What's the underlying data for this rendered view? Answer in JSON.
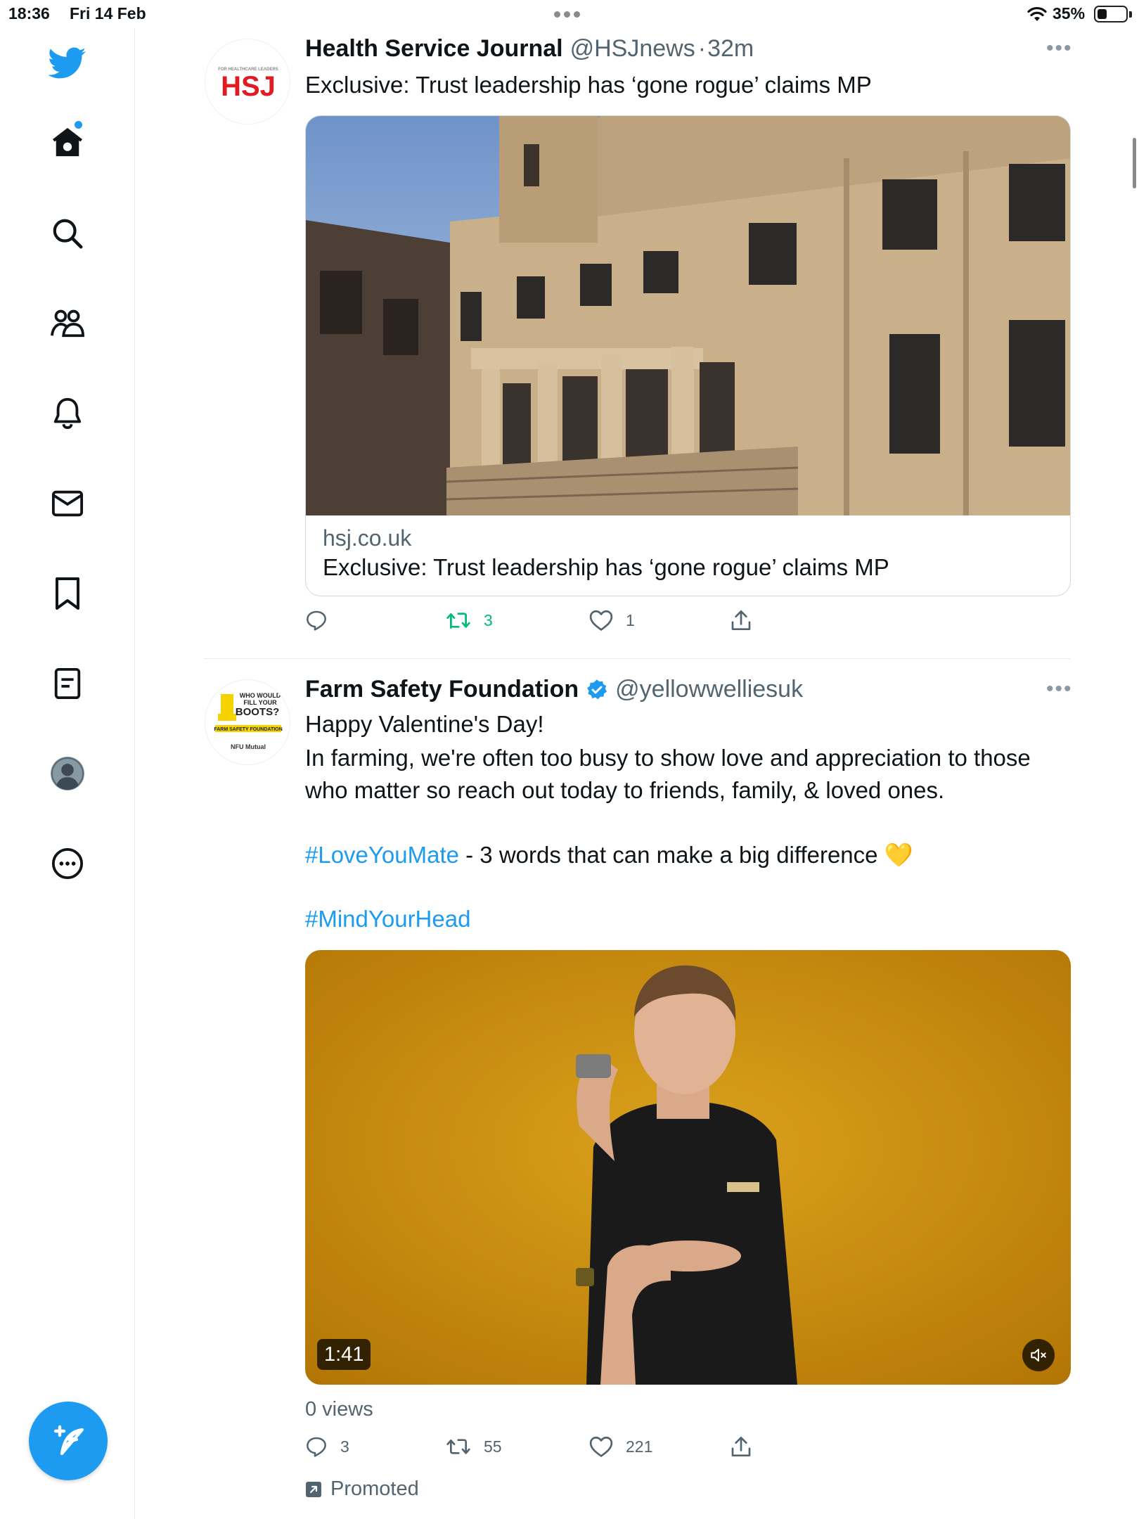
{
  "status_bar": {
    "time": "18:36",
    "date": "Fri 14 Feb",
    "battery": "35%"
  },
  "sidebar": {
    "items": [
      {
        "icon": "twitter-logo-icon"
      },
      {
        "icon": "home-icon"
      },
      {
        "icon": "search-icon"
      },
      {
        "icon": "communities-icon"
      },
      {
        "icon": "bell-icon"
      },
      {
        "icon": "mail-icon"
      },
      {
        "icon": "bookmark-icon"
      },
      {
        "icon": "lists-icon"
      },
      {
        "icon": "profile-icon"
      },
      {
        "icon": "more-icon"
      }
    ],
    "compose_icon": "compose-icon",
    "accent": "#1d9bf0"
  },
  "tweets": [
    {
      "name": "Health Service Journal",
      "handle": "@HSJnews",
      "separator": "·",
      "time": "32m",
      "text": "Exclusive: Trust leadership has ‘gone rogue’ claims MP",
      "avatar_logo_text": "HSJ",
      "avatar_logo_tagline": "FOR HEALTHCARE LEADERS",
      "card": {
        "domain": "hsj.co.uk",
        "title": "Exclusive: Trust leadership has ‘gone rogue’ claims MP"
      },
      "actions": {
        "replies": "",
        "retweets": "3",
        "likes": "1"
      }
    },
    {
      "name": "Farm Safety Foundation",
      "handle": "@yellowwelliesuk",
      "verified": true,
      "lines": [
        "Happy Valentine's Day!",
        "In farming, we're often too busy to show love and appreciation to those",
        "who matter so reach out today to friends, family, & loved ones."
      ],
      "hashtag1": "#LoveYouMate",
      "hashtag1_rest": " - 3 words that can make a big difference 💛",
      "hashtag2": "#MindYourHead",
      "avatar_logo_lines": [
        "WHO WOULD",
        "FILL YOUR",
        "BOOTS?",
        "FARM SAFETY FOUNDATION",
        "NFU Mutual"
      ],
      "video": {
        "duration": "1:41"
      },
      "views": "0 views",
      "actions": {
        "replies": "3",
        "retweets": "55",
        "likes": "221"
      },
      "promoted": "Promoted"
    }
  ],
  "colors": {
    "retweet_active": "#00ba7c",
    "video_background": "#c8860a"
  }
}
